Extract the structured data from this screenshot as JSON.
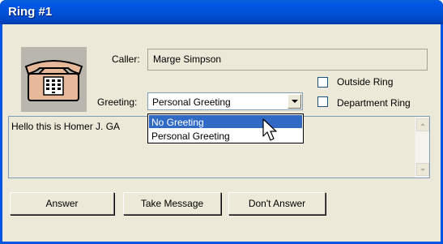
{
  "window": {
    "title": "Ring #1"
  },
  "icons": {
    "phone": "telephone-icon",
    "cursor": "mouse-pointer-icon"
  },
  "caller": {
    "label": "Caller:",
    "value": "Marge  Simpson"
  },
  "greeting": {
    "label": "Greeting:",
    "selected": "Personal Greeting",
    "options": [
      "No Greeting",
      "Personal Greeting"
    ],
    "highlighted_option": "No Greeting"
  },
  "options": {
    "outside_ring": {
      "label": "Outside Ring",
      "checked": false
    },
    "department_ring": {
      "label": "Department Ring",
      "checked": false
    }
  },
  "message": {
    "text": "Hello this is Homer J. GA"
  },
  "buttons": {
    "answer": "Answer",
    "take_message": "Take Message",
    "dont_answer": "Don't Answer"
  },
  "colors": {
    "titlebar": "#0054e3",
    "dialog_bg": "#ece9d8",
    "highlight": "#316ac5"
  }
}
